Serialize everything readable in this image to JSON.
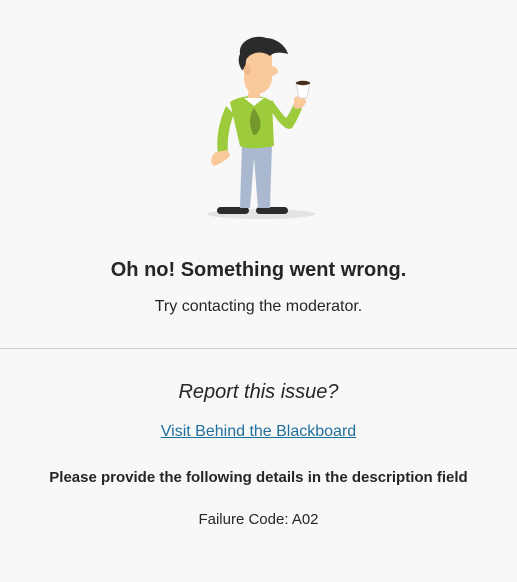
{
  "error": {
    "headline": "Oh no! Something went wrong.",
    "message": "Try contacting the moderator."
  },
  "report": {
    "title": "Report this issue?",
    "link_label": "Visit Behind the Blackboard",
    "instruction": "Please provide the following details in the description field",
    "failure_code": "Failure Code: A02"
  },
  "illustration": {
    "icon": "man-with-coffee-spill-illustration",
    "colors": {
      "shirt": "#9ccb3b",
      "hair": "#2b2b2b",
      "skin": "#f9c89b",
      "pants": "#aab8d0",
      "stain": "#6f8f2a",
      "shoes": "#2b2b2b",
      "shadow": "#e3e3e3"
    }
  },
  "colors": {
    "background": "#f8f8f8",
    "text": "#262626",
    "link": "#1f6f9c",
    "divider": "#cdcdcd"
  }
}
